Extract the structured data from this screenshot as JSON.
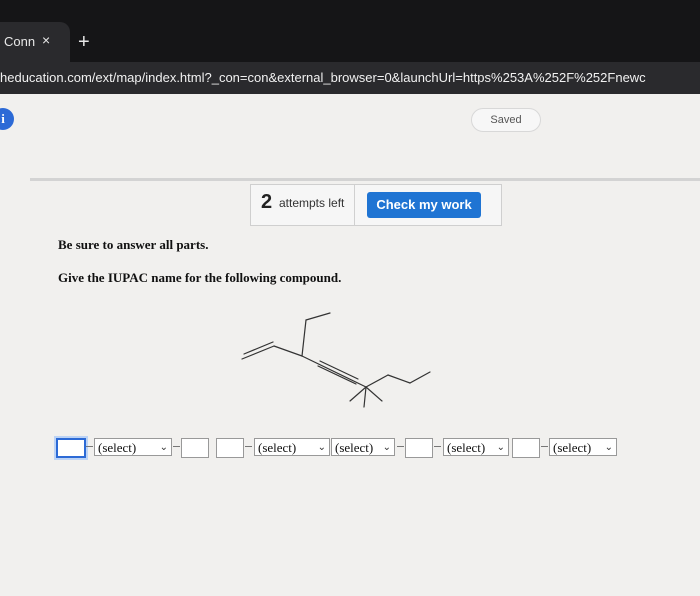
{
  "browser": {
    "tab_title": "Conn",
    "tab_close": "×",
    "new_tab": "+",
    "url": "heducation.com/ext/map/index.html?_con=con&external_browser=0&launchUrl=https%253A%252F%252Fnewc"
  },
  "header": {
    "info_icon": "i",
    "saved_label": "Saved"
  },
  "attempts": {
    "count": "2",
    "label": "attempts left",
    "check_button": "Check my work"
  },
  "question": {
    "instruction": "Be sure to answer all parts.",
    "prompt": "Give the IUPAC name for the following compound."
  },
  "answer": {
    "select_1": "(select)",
    "select_2": "(select)",
    "select_3": "(select)",
    "select_4": "(select)",
    "select_5": "(select)",
    "chevron": "⌄"
  },
  "colors": {
    "accent": "#1f74d3",
    "page_bg": "#f1f0ee",
    "browser_bg": "#2a2a2d"
  }
}
